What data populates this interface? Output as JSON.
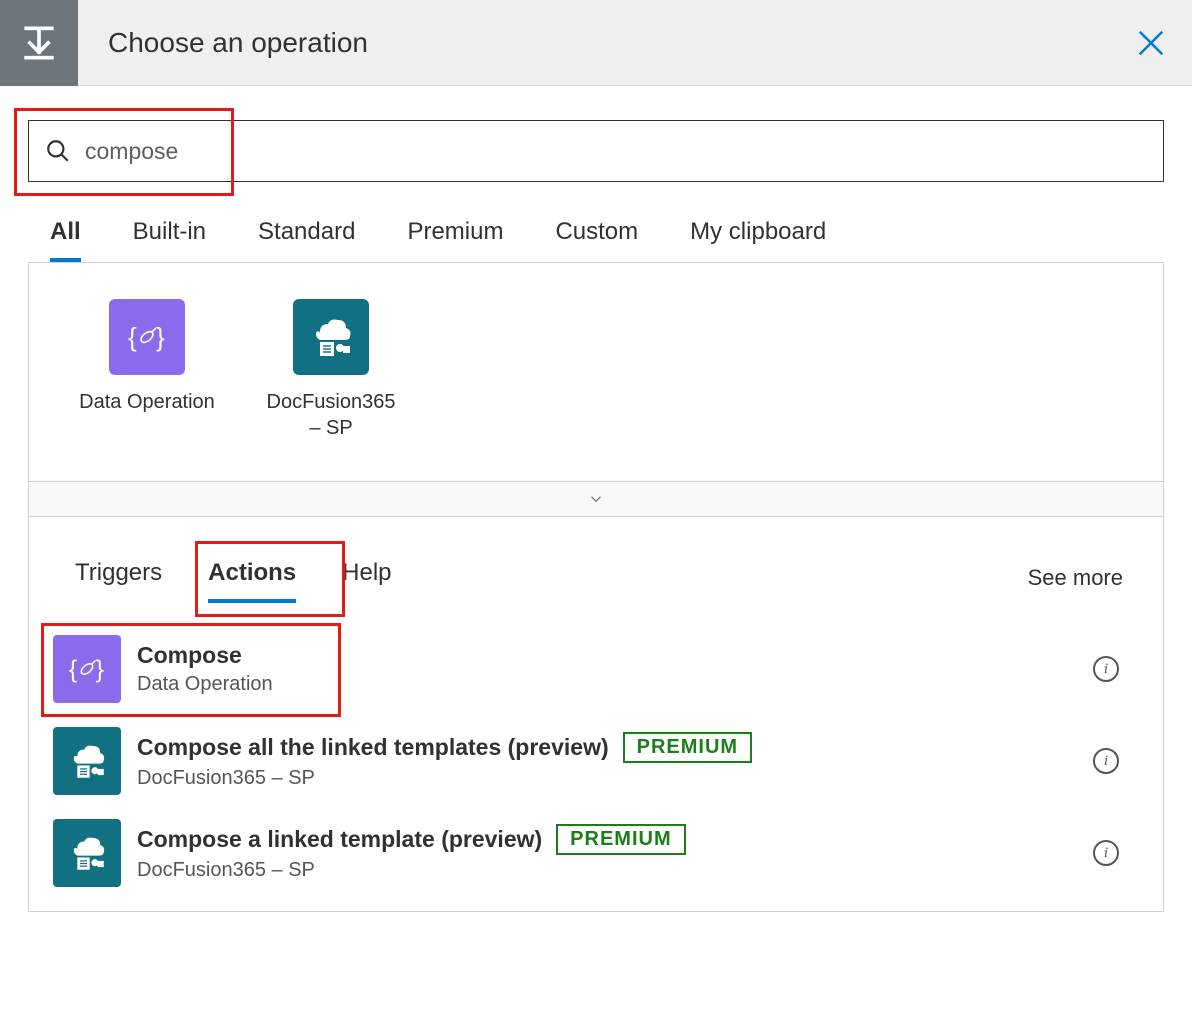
{
  "header": {
    "title": "Choose an operation"
  },
  "search": {
    "value": "compose"
  },
  "filter_tabs": [
    {
      "label": "All",
      "active": true
    },
    {
      "label": "Built-in",
      "active": false
    },
    {
      "label": "Standard",
      "active": false
    },
    {
      "label": "Premium",
      "active": false
    },
    {
      "label": "Custom",
      "active": false
    },
    {
      "label": "My clipboard",
      "active": false
    }
  ],
  "connectors": [
    {
      "label": "Data Operation",
      "icon": "data-operation",
      "color": "purple"
    },
    {
      "label": "DocFusion365 – SP",
      "icon": "docfusion",
      "color": "teal"
    }
  ],
  "subtabs": {
    "items": [
      {
        "label": "Triggers",
        "active": false
      },
      {
        "label": "Actions",
        "active": true
      },
      {
        "label": "Help",
        "active": false
      }
    ],
    "see_more": "See more"
  },
  "actions": [
    {
      "title": "Compose",
      "subtitle": "Data Operation",
      "icon": "data-operation",
      "color": "purple",
      "premium": false
    },
    {
      "title": "Compose all the linked templates (preview)",
      "subtitle": "DocFusion365 – SP",
      "icon": "docfusion",
      "color": "teal",
      "premium": true
    },
    {
      "title": "Compose a linked template (preview)",
      "subtitle": "DocFusion365 – SP",
      "icon": "docfusion",
      "color": "teal",
      "premium": true
    }
  ],
  "premium_label": "PREMIUM"
}
